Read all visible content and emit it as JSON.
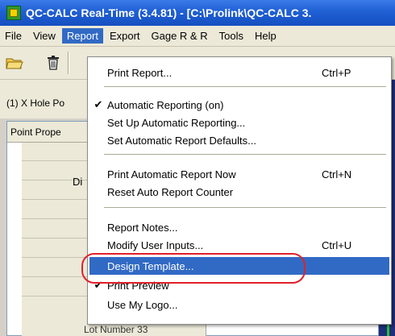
{
  "window": {
    "title": "QC-CALC Real-Time (3.4.81) - [C:\\Prolink\\QC-CALC 3."
  },
  "menubar": {
    "items": [
      {
        "label": "File"
      },
      {
        "label": "View"
      },
      {
        "label": "Report"
      },
      {
        "label": "Export"
      },
      {
        "label": "Gage R & R"
      },
      {
        "label": "Tools"
      },
      {
        "label": "Help"
      }
    ],
    "active_index": 2
  },
  "toolbar": {
    "buttons": [
      {
        "icon": "open-folder-icon"
      },
      {
        "icon": "trash-icon"
      },
      {
        "icon": "print-icon"
      }
    ]
  },
  "hole_bar": {
    "label": "(1) X Hole Po"
  },
  "panel": {
    "header": "Point Prope",
    "row_label": "Di"
  },
  "bottom_hint": {
    "text": "Lot Number     33"
  },
  "report_menu": {
    "groups": [
      [
        {
          "label": "Print Report...",
          "shortcut": "Ctrl+P",
          "checked": false
        }
      ],
      [
        {
          "label": "Automatic Reporting (on)",
          "shortcut": "",
          "checked": true
        },
        {
          "label": "Set Up Automatic Reporting...",
          "shortcut": "",
          "checked": false
        },
        {
          "label": "Set Automatic Report Defaults...",
          "shortcut": "",
          "checked": false
        }
      ],
      [
        {
          "label": "Print Automatic Report Now",
          "shortcut": "Ctrl+N",
          "checked": false
        },
        {
          "label": "Reset Auto Report Counter",
          "shortcut": "",
          "checked": false
        }
      ],
      [
        {
          "label": "Report Notes...",
          "shortcut": "",
          "checked": false
        },
        {
          "label": "Modify User Inputs...",
          "shortcut": "Ctrl+U",
          "checked": false
        },
        {
          "label": "Design Template...",
          "shortcut": "",
          "checked": false,
          "highlighted": true
        },
        {
          "label": "Print Preview",
          "shortcut": "",
          "checked": true
        },
        {
          "label": "Use My Logo...",
          "shortcut": "",
          "checked": false
        }
      ]
    ]
  },
  "colors": {
    "titlebar": "#1f5fd4",
    "highlight": "#316ac5",
    "annotation_circle": "#e0202a"
  }
}
